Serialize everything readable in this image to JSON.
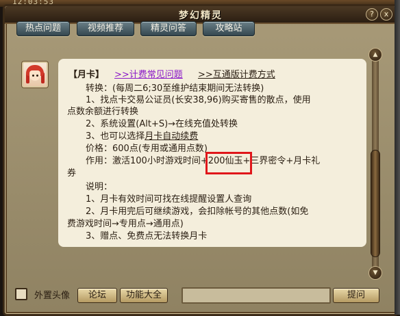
{
  "topstrip": {
    "clock": "12:03:53"
  },
  "window": {
    "title": "梦幻精灵",
    "help_btn": "?",
    "close_btn": "x"
  },
  "tabs": [
    "热点问题",
    "视频推荐",
    "精灵问答",
    "攻略站"
  ],
  "content": {
    "heading": "【月卡】",
    "link1": ">>计费常见问题",
    "link2": ">>互通版计费方式",
    "lines": [
      "转换：(每周二6;30至维护结束期间无法转换)",
      "1、找点卡交易公证员(长安38,96)购买寄售的散点，使用",
      "点数余额进行转换",
      "2、系统设置(Alt+S)→在线充值处转换",
      "价格：600点(专用或通用点数)",
      "作用：激活100小时游戏时间+200仙玉+三界密令+月卡礼",
      "券",
      "说明：",
      "1、月卡有效时间可找在线提醒设置人查询",
      "2、月卡用完后可继续游戏，会扣除帐号的其他点数(如免",
      "费游戏时间→专用点→通用点)",
      "3、赠点、免费点无法转换月卡"
    ],
    "line3_prefix": "3、也可以选择",
    "line3_link": "月卡自动续费"
  },
  "scroll": {
    "up": "▲",
    "down": "▼"
  },
  "bottombar": {
    "checkbox_label": "外置头像",
    "forum": "论坛",
    "features": "功能大全",
    "ask": "提问",
    "input_value": ""
  },
  "colors": {
    "highlight": "#e0161a",
    "link": "#8a18c8"
  }
}
